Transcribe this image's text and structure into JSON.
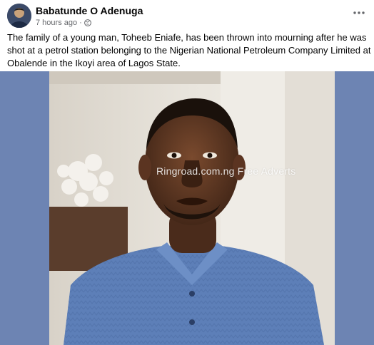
{
  "post": {
    "author": "Babatunde O Adenuga",
    "timestamp": "7 hours ago",
    "separator": "·",
    "audience_icon": "globe-icon",
    "more_icon": "more-options-icon",
    "caption": "The family of a young man, Toheeb Eniafe, has been thrown into mourning after he was shot at a petrol station belonging to the Nigerian National Petroleum Company Limited at Obalende in the Ikoyi area of  Lagos State.",
    "photo_watermark": "Ringroad.com.ng Free Adverts"
  },
  "colors": {
    "media_background": "#6d84b3",
    "author_text": "#050505",
    "meta_text": "#65676b",
    "shirt": "#5d7fb8"
  }
}
